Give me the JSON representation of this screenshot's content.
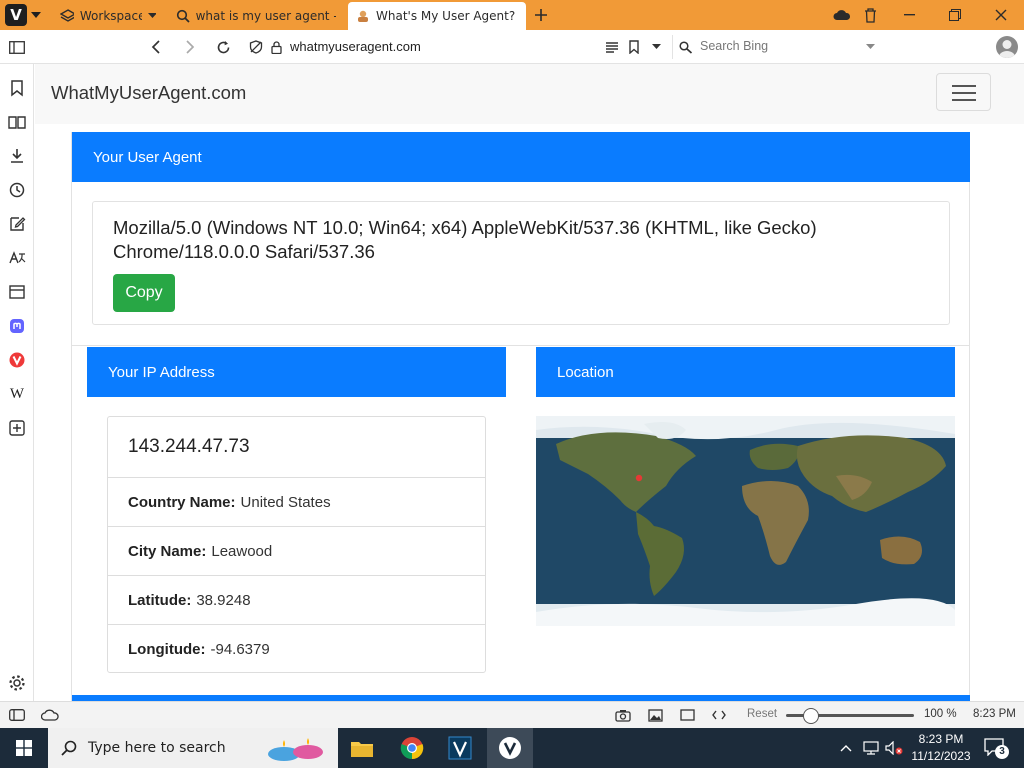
{
  "browser": {
    "workspaces_label": "Workspaces",
    "tabs": [
      {
        "title": "what is my user agent - Sea"
      },
      {
        "title": "What's My User Agent?"
      }
    ],
    "url": "whatmyuseragent.com",
    "search_placeholder": "Search Bing"
  },
  "page": {
    "brand": "WhatMyUserAgent.com",
    "user_agent_header": "Your User Agent",
    "user_agent": "Mozilla/5.0 (Windows NT 10.0; Win64; x64) AppleWebKit/537.36 (KHTML, like Gecko) Chrome/118.0.0.0 Safari/537.36",
    "copy_label": "Copy",
    "ip_header": "Your IP Address",
    "location_header": "Location",
    "ip_address": "143.244.47.73",
    "details": [
      {
        "label": "Country Name:",
        "value": "United States"
      },
      {
        "label": "City Name:",
        "value": "Leawood"
      },
      {
        "label": "Latitude:",
        "value": "38.9248"
      },
      {
        "label": "Longitude:",
        "value": "-94.6379"
      }
    ]
  },
  "statusbar": {
    "reset_label": "Reset",
    "zoom": "100 %",
    "clock": "8:23 PM"
  },
  "taskbar": {
    "search_placeholder": "Type here to search",
    "time": "8:23 PM",
    "date": "11/12/2023",
    "notification_count": "3"
  },
  "colors": {
    "tabbar": "#f19a37",
    "card_header": "#0a7cff",
    "copy_button": "#28a745"
  }
}
